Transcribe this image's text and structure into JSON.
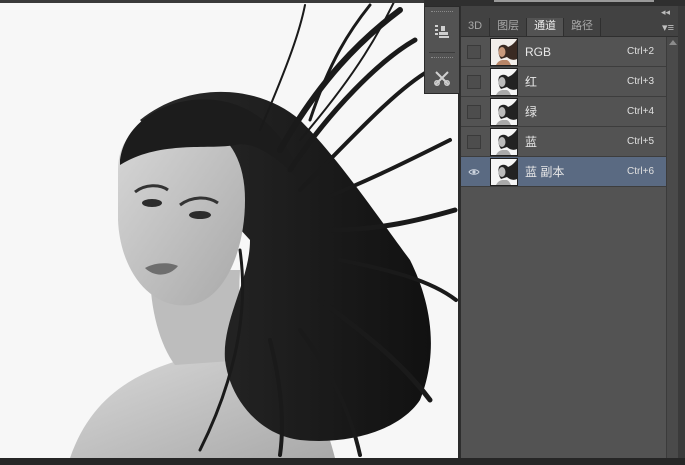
{
  "panel": {
    "tabs": [
      {
        "label": "3D",
        "active": false
      },
      {
        "label": "图层",
        "active": false
      },
      {
        "label": "通道",
        "active": true
      },
      {
        "label": "路径",
        "active": false
      }
    ],
    "menu_icon": "panel-menu-icon",
    "collapse_icon": "double-chevron-icon"
  },
  "channels": [
    {
      "label": "RGB",
      "shortcut": "Ctrl+2",
      "visible": false,
      "selected": false,
      "thumb": "color"
    },
    {
      "label": "红",
      "shortcut": "Ctrl+3",
      "visible": false,
      "selected": false,
      "thumb": "gray"
    },
    {
      "label": "绿",
      "shortcut": "Ctrl+4",
      "visible": false,
      "selected": false,
      "thumb": "gray"
    },
    {
      "label": "蓝",
      "shortcut": "Ctrl+5",
      "visible": false,
      "selected": false,
      "thumb": "gray"
    },
    {
      "label": "蓝 副本",
      "shortcut": "Ctrl+6",
      "visible": true,
      "selected": true,
      "thumb": "gray"
    }
  ],
  "toolstrip": {
    "tools": [
      "stamp-source-icon",
      "tool-presets-icon"
    ]
  },
  "colors": {
    "panel_bg": "#535353",
    "selected_row": "#5a6a82",
    "canvas_bg": "#f7f7f7"
  }
}
